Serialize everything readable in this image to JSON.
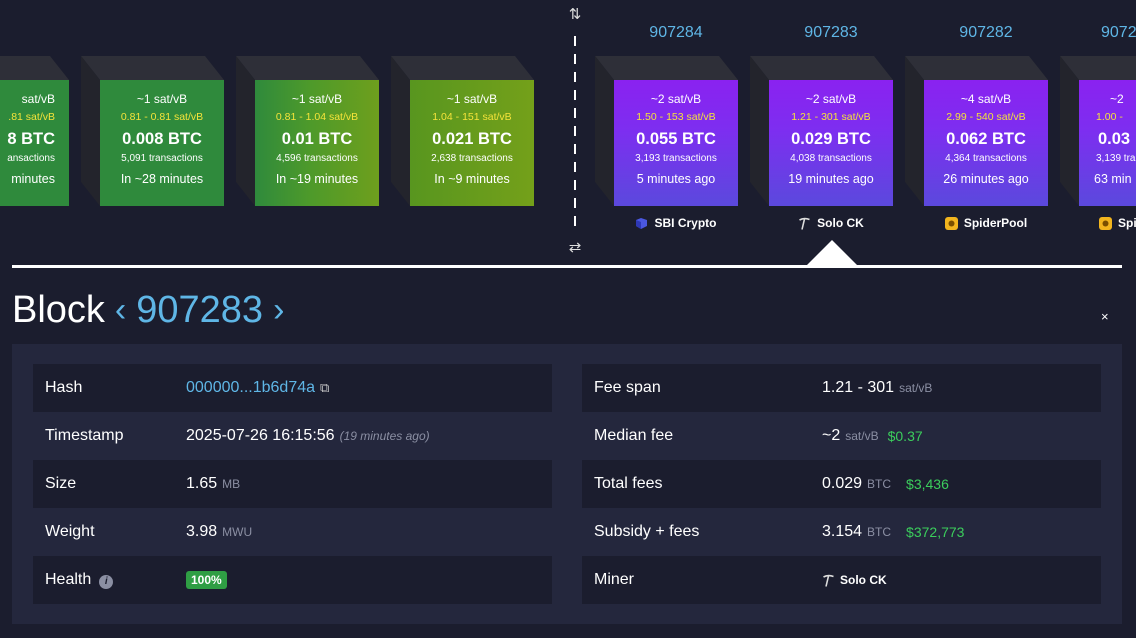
{
  "mempool_blocks": [
    {
      "fee": "~1 sat/vB",
      "span": "0.81 - 0.81 sat/vB",
      "btc": "0.008 BTC",
      "tx": "5,091 transactions",
      "time": "In ~28 minutes"
    },
    {
      "fee": "~1 sat/vB",
      "span": "0.81 - 1.04 sat/vB",
      "btc": "0.01 BTC",
      "tx": "4,596 transactions",
      "time": "In ~19 minutes"
    },
    {
      "fee": "~1 sat/vB",
      "span": "1.04 - 151 sat/vB",
      "btc": "0.021 BTC",
      "tx": "2,638 transactions",
      "time": "In ~9 minutes"
    }
  ],
  "partial_mempool_block": {
    "fee": "sat/vB",
    "span": ".81 sat/vB",
    "btc": "8 BTC",
    "tx": "ansactions",
    "time": "minutes"
  },
  "mined_blocks": [
    {
      "height": "907284",
      "fee": "~2 sat/vB",
      "span": "1.50 - 153 sat/vB",
      "btc": "0.055 BTC",
      "tx": "3,193 transactions",
      "time": "5 minutes ago",
      "pool": "SBI Crypto",
      "pool_icon": "sbi-crypto-icon"
    },
    {
      "height": "907283",
      "fee": "~2 sat/vB",
      "span": "1.21 - 301 sat/vB",
      "btc": "0.029 BTC",
      "tx": "4,038 transactions",
      "time": "19 minutes ago",
      "pool": "Solo CK",
      "pool_icon": "pickaxe-icon"
    },
    {
      "height": "907282",
      "fee": "~4 sat/vB",
      "span": "2.99 - 540 sat/vB",
      "btc": "0.062 BTC",
      "tx": "4,364 transactions",
      "time": "26 minutes ago",
      "pool": "SpiderPool",
      "pool_icon": "spiderpool-icon"
    },
    {
      "height": "9072",
      "fee": "~2",
      "span": "1.00 -",
      "btc": "0.03",
      "tx": "3,139 tra",
      "time": "63 min",
      "pool": "Spi",
      "pool_icon": "spiderpool-icon"
    }
  ],
  "icons": {
    "switch_top": "⇅",
    "switch_bottom": "⇄",
    "copy": "⧉",
    "close": "×",
    "info": "i",
    "nav_prev": "‹",
    "nav_next": "›"
  },
  "block": {
    "title": "Block",
    "number": "907283",
    "left": [
      {
        "label": "Hash",
        "value": "000000...1b6d74a"
      },
      {
        "label": "Timestamp",
        "value": "2025-07-26 16:15:56",
        "ago": "(19 minutes ago)"
      },
      {
        "label": "Size",
        "value": "1.65",
        "unit": "MB"
      },
      {
        "label": "Weight",
        "value": "3.98",
        "unit": "MWU"
      },
      {
        "label": "Health",
        "value": "100%"
      }
    ],
    "right": [
      {
        "label": "Fee span",
        "value": "1.21 - 301",
        "unit": "sat/vB"
      },
      {
        "label": "Median fee",
        "value": "~2",
        "unit": "sat/vB",
        "usd": "$0.37"
      },
      {
        "label": "Total fees",
        "value": "0.029",
        "unit": "BTC",
        "usd": "$3,436"
      },
      {
        "label": "Subsidy + fees",
        "value": "3.154",
        "unit": "BTC",
        "usd": "$372,773"
      },
      {
        "label": "Miner",
        "value": "Solo CK"
      }
    ]
  },
  "colors": {
    "accent": "#5fb6e6",
    "usd_green": "#3bcd5c",
    "health_badge": "#2f9e44",
    "mined_purple": "#8a22f0",
    "mempool_green": "#2f8a3c"
  }
}
